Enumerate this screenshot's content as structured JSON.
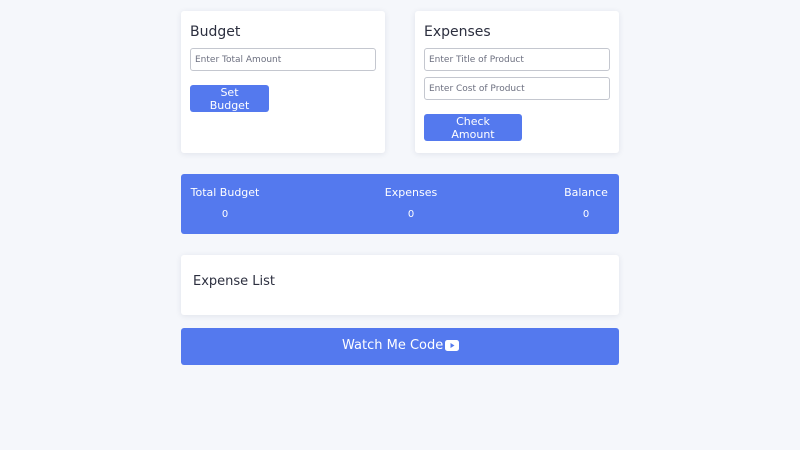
{
  "budget": {
    "title": "Budget",
    "amount_placeholder": "Enter Total Amount",
    "amount_value": "",
    "set_button": "Set Budget"
  },
  "expenses": {
    "title": "Expenses",
    "title_placeholder": "Enter Title of Product",
    "title_value": "",
    "cost_placeholder": "Enter Cost of Product",
    "cost_value": "",
    "check_button": "Check Amount"
  },
  "summary": {
    "total_budget_label": "Total Budget",
    "total_budget_value": "0",
    "expenses_label": "Expenses",
    "expenses_value": "0",
    "balance_label": "Balance",
    "balance_value": "0"
  },
  "expense_list": {
    "title": "Expense List",
    "items": []
  },
  "watch": {
    "label": "Watch Me Code",
    "icon": "youtube-icon"
  },
  "colors": {
    "accent": "#5479ee",
    "background": "#f5f7fb",
    "card": "#ffffff",
    "text": "#2c2f3f"
  }
}
